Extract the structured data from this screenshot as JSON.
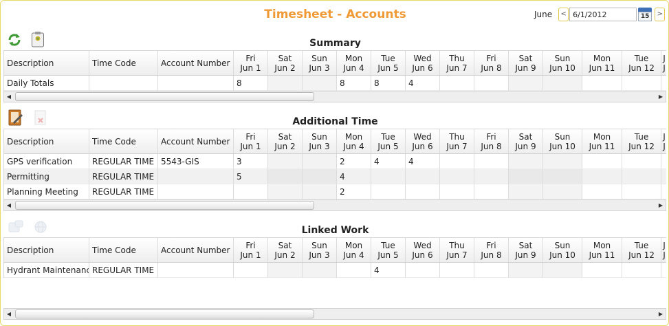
{
  "page_title": "Timesheet - Accounts",
  "date_nav": {
    "month": "June",
    "prev_label": "<",
    "next_label": ">",
    "date_value": "6/1/2012",
    "calendar_day": "15"
  },
  "columns": {
    "description": "Description",
    "time_code": "Time Code",
    "account_number": "Account Number",
    "days": [
      {
        "dow": "Fri",
        "date": "Jun 1"
      },
      {
        "dow": "Sat",
        "date": "Jun 2"
      },
      {
        "dow": "Sun",
        "date": "Jun 3"
      },
      {
        "dow": "Mon",
        "date": "Jun 4"
      },
      {
        "dow": "Tue",
        "date": "Jun 5"
      },
      {
        "dow": "Wed",
        "date": "Jun 6"
      },
      {
        "dow": "Thu",
        "date": "Jun 7"
      },
      {
        "dow": "Fri",
        "date": "Jun 8"
      },
      {
        "dow": "Sat",
        "date": "Jun 9"
      },
      {
        "dow": "Sun",
        "date": "Jun 10"
      },
      {
        "dow": "Mon",
        "date": "Jun 11"
      },
      {
        "dow": "Tue",
        "date": "Jun 12"
      },
      {
        "dow": "J",
        "date": "J"
      }
    ]
  },
  "summary": {
    "title": "Summary",
    "toolbar": {
      "refresh_icon": "refresh-icon",
      "clipboard_icon": "clipboard-icon"
    },
    "rows": [
      {
        "description": "Daily Totals",
        "time_code": "",
        "account": "",
        "values": [
          "8",
          "",
          "",
          "8",
          "8",
          "4",
          "",
          "",
          "",
          "",
          "",
          "",
          ""
        ]
      }
    ]
  },
  "additional": {
    "title": "Additional Time",
    "toolbar": {
      "edit_icon": "edit-document-icon",
      "delete_icon": "delete-document-icon"
    },
    "rows": [
      {
        "description": "GPS verification",
        "time_code": "REGULAR TIME",
        "account": "5543-GIS",
        "values": [
          "3",
          "",
          "",
          "2",
          "4",
          "4",
          "",
          "",
          "",
          "",
          "",
          "",
          ""
        ]
      },
      {
        "description": "Permitting",
        "time_code": "REGULAR TIME",
        "account": "",
        "values": [
          "5",
          "",
          "",
          "4",
          "",
          "",
          "",
          "",
          "",
          "",
          "",
          "",
          ""
        ]
      },
      {
        "description": "Planning Meeting",
        "time_code": "REGULAR TIME",
        "account": "",
        "values": [
          "",
          "",
          "",
          "2",
          "",
          "",
          "",
          "",
          "",
          "",
          "",
          "",
          ""
        ]
      }
    ]
  },
  "linked": {
    "title": "Linked Work",
    "toolbar": {
      "link_icon": "link-work-icon",
      "globe_icon": "globe-icon"
    },
    "rows": [
      {
        "description": "Hydrant Maintenance",
        "time_code": "REGULAR TIME",
        "account": "",
        "values": [
          "",
          "",
          "",
          "",
          "4",
          "",
          "",
          "",
          "",
          "",
          "",
          "",
          ""
        ]
      }
    ]
  },
  "colors": {
    "title": "#ef9a36",
    "nav_border": "#e0c94e",
    "frame_border": "#e6d96a"
  }
}
